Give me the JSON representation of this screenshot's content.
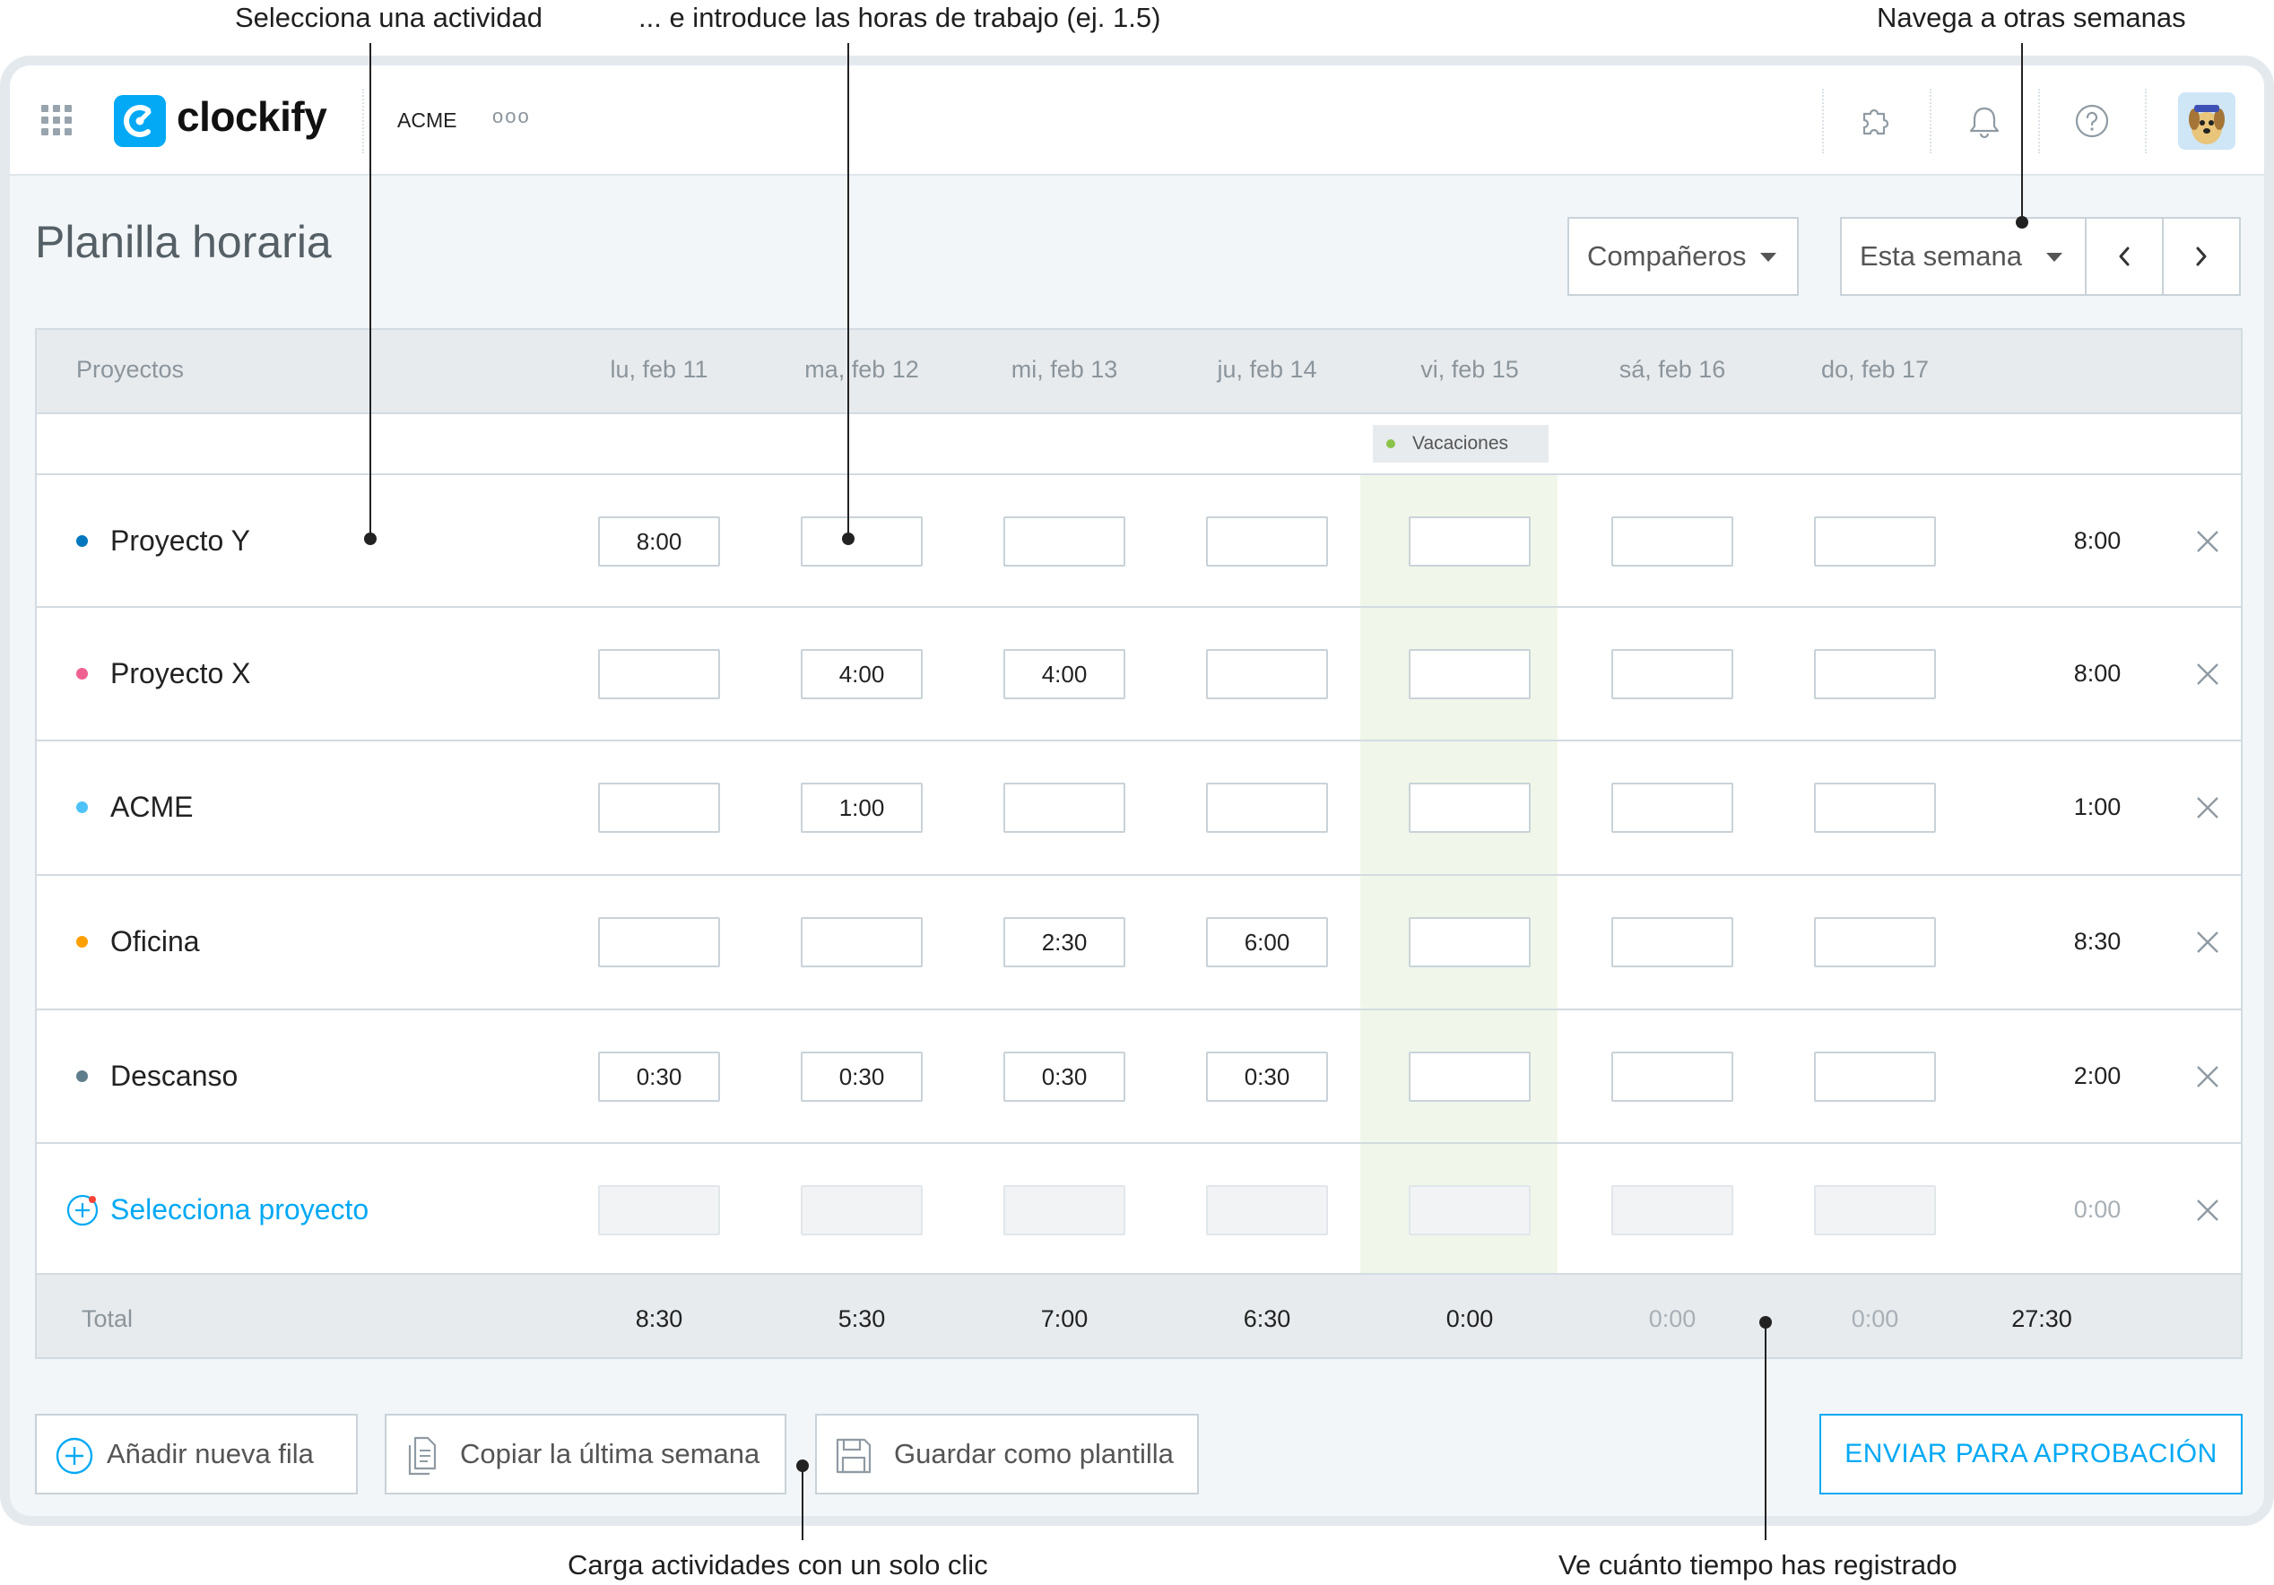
{
  "annotations": {
    "select_activity": "Selecciona una actividad",
    "enter_hours": "... e introduce las horas de trabajo (ej. 1.5)",
    "navigate_weeks": "Navega a otras semanas",
    "one_click": "Carga actividades con un solo clic",
    "see_time": "Ve cuánto tiempo has registrado"
  },
  "app": {
    "logo_text": "clockify",
    "workspace": "ACME",
    "more_glyph": "ooo",
    "brand_color": "#03a9f4"
  },
  "topbar_icons": [
    "apps-grid-icon",
    "puzzle-icon",
    "bell-icon",
    "help-icon",
    "avatar"
  ],
  "page": {
    "title": "Planilla horaria",
    "teammates_label": "Compañeros",
    "week_label": "Esta semana"
  },
  "table": {
    "projects_header": "Proyectos",
    "days": [
      "lu, feb 11",
      "ma, feb 12",
      "mi, feb 13",
      "ju, feb 14",
      "vi, feb 15",
      "sá, feb 16",
      "do, feb 17"
    ],
    "holiday_label": "Vacaciones",
    "holiday_color": "#8bc34a",
    "rows": [
      {
        "project": "Proyecto Y",
        "color": "#0277bd",
        "hours": [
          "8:00",
          "",
          "",
          "",
          "",
          "",
          ""
        ],
        "total": "8:00"
      },
      {
        "project": "Proyecto X",
        "color": "#f06292",
        "hours": [
          "",
          "4:00",
          "4:00",
          "",
          "",
          "",
          ""
        ],
        "total": "8:00"
      },
      {
        "project": "ACME",
        "color": "#4fc3f7",
        "hours": [
          "",
          "1:00",
          "",
          "",
          "",
          "",
          ""
        ],
        "total": "1:00"
      },
      {
        "project": "Oficina",
        "color": "#ffa000",
        "hours": [
          "",
          "",
          "2:30",
          "6:00",
          "",
          "",
          ""
        ],
        "total": "8:30"
      },
      {
        "project": "Descanso",
        "color": "#607d8b",
        "hours": [
          "0:30",
          "0:30",
          "0:30",
          "0:30",
          "",
          "",
          ""
        ],
        "total": "2:00"
      }
    ],
    "new_row": {
      "label": "Selecciona proyecto",
      "total": "0:00"
    },
    "footer": {
      "label": "Total",
      "day_totals": [
        "8:30",
        "5:30",
        "7:00",
        "6:30",
        "0:00",
        "0:00",
        "0:00"
      ],
      "grand_total": "27:30"
    }
  },
  "actions": {
    "add_row": "Añadir nueva fila",
    "copy_last_week": "Copiar la última semana",
    "save_template": "Guardar como plantilla",
    "submit": "ENVIAR PARA APROBACIÓN"
  }
}
